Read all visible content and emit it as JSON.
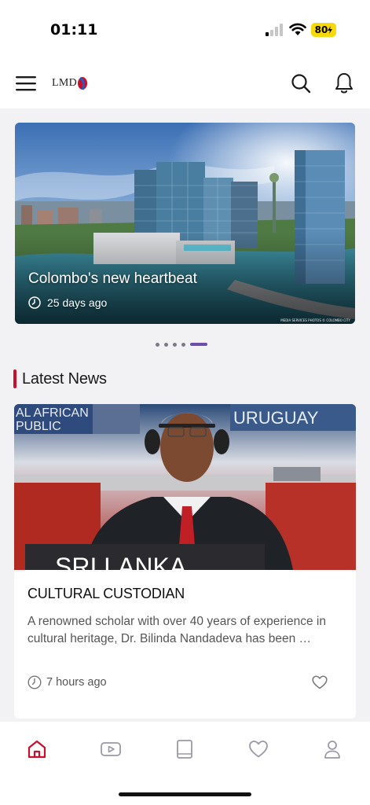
{
  "status_bar": {
    "time": "01:11",
    "battery": "80"
  },
  "header": {
    "logo_text": "LMD",
    "menu_icon": "hamburger-menu-icon",
    "search_icon": "search-icon",
    "notification_icon": "bell-icon"
  },
  "hero": {
    "title": "Colombo's new heartbeat",
    "time": "25 days ago",
    "credit": "MEDIA SERVICES PHOTOS © COLOMBO CITY",
    "slide_count": 5,
    "active_slide": 5
  },
  "latest_news": {
    "heading": "Latest News",
    "card": {
      "title": "CULTURAL CUSTODIAN",
      "summary": "A renowned scholar with over 40 years of experience in cultural heritage, Dr. Bilinda Nandadeva has been …",
      "time": "7 hours ago",
      "image_text": {
        "left_sign": "AL AFRICAN\nPUBLIC",
        "right_sign": "URUGUAY",
        "nameplate": "SRI LANKA"
      }
    }
  },
  "bottom_nav": {
    "items": [
      {
        "icon": "home-icon",
        "active": true
      },
      {
        "icon": "video-icon",
        "active": false
      },
      {
        "icon": "book-icon",
        "active": false
      },
      {
        "icon": "heart-icon",
        "active": false
      },
      {
        "icon": "profile-icon",
        "active": false
      }
    ]
  },
  "colors": {
    "accent": "#c8102e",
    "active_dot": "#6b4fa8",
    "icon_gray": "#9a9aa6",
    "battery": "#f5d90a"
  }
}
